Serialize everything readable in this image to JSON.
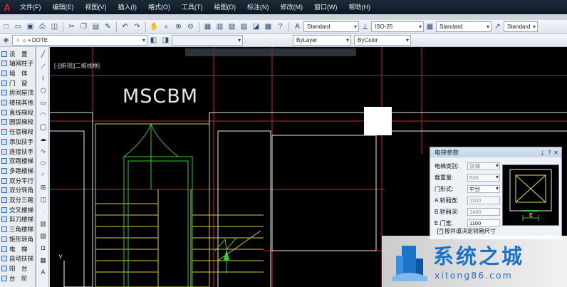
{
  "menubar": {
    "items": [
      "文件(F)",
      "编辑(E)",
      "视图(V)",
      "插入(I)",
      "格式(O)",
      "工具(T)",
      "绘图(D)",
      "标注(N)",
      "修改(M)",
      "窗口(W)",
      "帮助(H)"
    ]
  },
  "toolbar": {
    "text_style": "Standard",
    "dim_style": "ISO-25",
    "table_style": "Standard",
    "multileader_style": "Standard",
    "layer_name": "DOTE",
    "linetype": "ByLayer",
    "lineweight": "ByColor"
  },
  "palette": {
    "items": [
      "设　置",
      "轴网柱子",
      "墙　体",
      "门　窗",
      "房间屋顶",
      "楼梯其他",
      "直线梯段",
      "圆弧梯段",
      "任意梯段",
      "添加扶手",
      "连接扶手",
      "双跑楼梯",
      "多跑楼梯",
      "双分平行",
      "双分转角",
      "双分三跑",
      "交叉楼梯",
      "剪刀楼梯",
      "三角楼梯",
      "矩形转角",
      "电　梯",
      "自动扶梯",
      "阳　台",
      "台　阶"
    ]
  },
  "canvas": {
    "view_label": "[-][俯视][二维线框]",
    "drawing_text": "MSCBM",
    "ucs_y": "Y"
  },
  "dialog": {
    "title": "电梯参数",
    "fields": [
      {
        "label": "电梯类别:",
        "value": "货梯"
      },
      {
        "label": "载重量:",
        "value": "630"
      },
      {
        "label": "门形式:",
        "value": "中分"
      },
      {
        "label": "A.轿厢宽:",
        "value": "1100"
      },
      {
        "label": "B.轿厢深:",
        "value": "1400"
      },
      {
        "label": "E.门宽:",
        "value": "1100"
      }
    ],
    "checkbox_label": "按井道决定轿厢尺寸",
    "preview_dim": "E",
    "colors": {
      "arrow": "#e0202a"
    }
  },
  "watermark": {
    "title": "系统之城",
    "url": "xitong86.com"
  }
}
